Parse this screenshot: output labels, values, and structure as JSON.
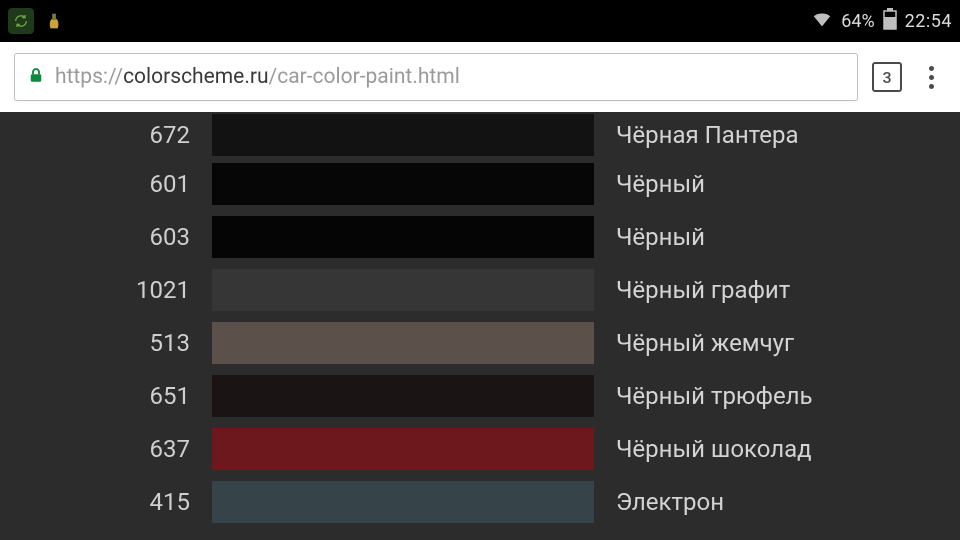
{
  "statusbar": {
    "battery_pct": "64%",
    "time": "22:54"
  },
  "toolbar": {
    "url_scheme": "https://",
    "url_host": "colorscheme.ru",
    "url_path": "/car-color-paint.html",
    "tab_count": "3"
  },
  "colors": [
    {
      "code": "672",
      "name": "Чёрная Пантера",
      "hex": "#121212"
    },
    {
      "code": "601",
      "name": "Чёрный",
      "hex": "#060606"
    },
    {
      "code": "603",
      "name": "Чёрный",
      "hex": "#050505"
    },
    {
      "code": "1021",
      "name": "Чёрный графит",
      "hex": "#363636"
    },
    {
      "code": "513",
      "name": "Чёрный жемчуг",
      "hex": "#5c514a"
    },
    {
      "code": "651",
      "name": "Чёрный трюфель",
      "hex": "#1a1414"
    },
    {
      "code": "637",
      "name": "Чёрный шоколад",
      "hex": "#6d181c"
    },
    {
      "code": "415",
      "name": "Электрон",
      "hex": "#364449"
    }
  ]
}
